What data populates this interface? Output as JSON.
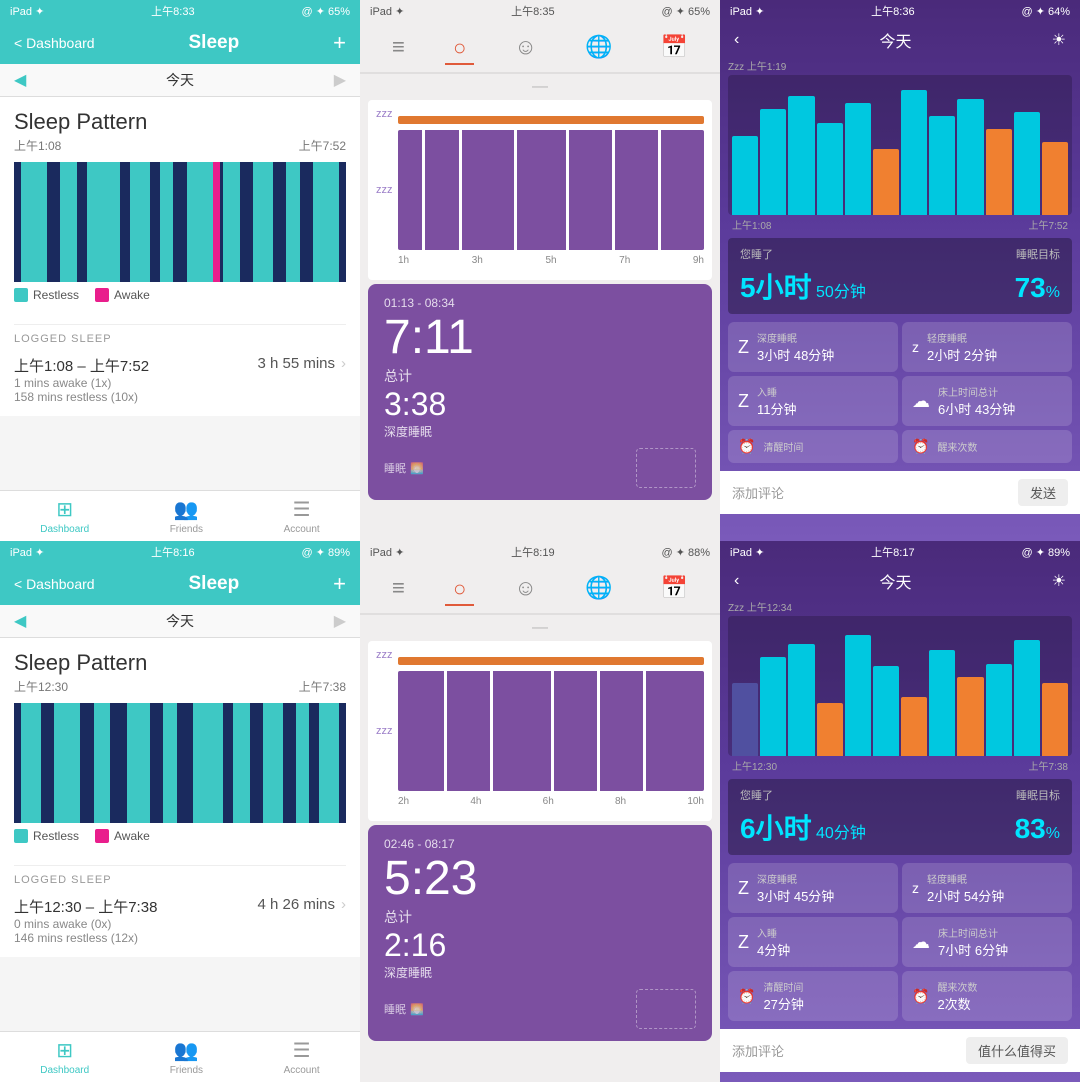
{
  "panels": {
    "topLeft": {
      "statusBar": {
        "left": "iPad ✦",
        "time": "上午8:33",
        "right": "@ ✦ 65%"
      },
      "navBack": "< Dashboard",
      "navTitle": "Sleep",
      "navAdd": "+",
      "dateLabel": "今天",
      "sleepPatternTitle": "Sleep Pattern",
      "startTime": "上午1:08",
      "endTime": "上午7:52",
      "legend": [
        {
          "color": "#3ec8c4",
          "label": "Restless"
        },
        {
          "color": "#e91e8c",
          "label": "Awake"
        }
      ],
      "loggedSleepLabel": "LOGGED SLEEP",
      "entry": {
        "timeRange": "上午1:08 – 上午7:52",
        "detail1": "1 mins awake (1x)",
        "detail2": "158 mins restless (10x)",
        "duration": "3 h 55 mins"
      },
      "tabs": [
        {
          "icon": "⊞",
          "label": "Dashboard",
          "active": true
        },
        {
          "icon": "👥",
          "label": "Friends",
          "active": false
        },
        {
          "icon": "☰",
          "label": "Account",
          "active": false
        }
      ]
    },
    "topMiddle": {
      "statusBar": {
        "left": "iPad ✦",
        "time": "上午8:35",
        "right": "@ ✦ 65%"
      },
      "navIcons": [
        "≡",
        "○",
        "☺",
        "🌐",
        "📅"
      ],
      "activeNavIndex": 1,
      "zzzTop": "zzz",
      "zzzMid": "zzz",
      "timeLabels": [
        "1h",
        "3h",
        "5h",
        "7h",
        "9h"
      ],
      "cardTimeRange": "01:13 - 08:34",
      "cardMainTime": "7:11",
      "cardTotalLabel": "总计",
      "cardDeepTime": "3:38",
      "cardDeepLabel": "深度睡眠",
      "cardFooter": "睡眠"
    },
    "topRight": {
      "statusBar": {
        "left": "iPad ✦",
        "time": "上午8:36",
        "right": "@ ✦ 64%"
      },
      "navTitle": "今天",
      "zzzLabel": "Zzz 上午1:19",
      "timeStart": "上午1:08",
      "timeEnd": "上午7:52",
      "sleptLabel": "您睡了",
      "goalLabel": "睡眠目标",
      "bigHours": "5小时",
      "bigMin": "50分钟",
      "percent": "73",
      "percentSign": "%",
      "stats": [
        {
          "icon": "Z",
          "label": "深度睡眠",
          "value": "3小时 48分钟"
        },
        {
          "icon": "z",
          "label": "轻度睡眠",
          "value": "2小时 2分钟"
        },
        {
          "icon": "Z",
          "label": "入睡",
          "value": "11分钟"
        },
        {
          "icon": "☁",
          "label": "床上时间总计",
          "value": "6小时 43分钟"
        },
        {
          "icon": "⏰",
          "label": "清醒时间",
          "value": ""
        },
        {
          "icon": "⏰",
          "label": "醒来次数",
          "value": ""
        }
      ],
      "commentPlaceholder": "添加评论",
      "sendLabel": "发送"
    },
    "bottomLeft": {
      "statusBar": {
        "left": "iPad ✦",
        "time": "上午8:16",
        "right": "@ ✦ 89%"
      },
      "navBack": "< Dashboard",
      "navTitle": "Sleep",
      "navAdd": "+",
      "dateLabel": "今天",
      "sleepPatternTitle": "Sleep Pattern",
      "startTime": "上午12:30",
      "endTime": "上午7:38",
      "loggedSleepLabel": "LOGGED SLEEP",
      "entry": {
        "timeRange": "上午12:30 – 上午7:38",
        "detail1": "0 mins awake (0x)",
        "detail2": "146 mins restless (12x)",
        "duration": "4 h 26 mins"
      },
      "tabs": [
        {
          "icon": "⊞",
          "label": "Dashboard",
          "active": true
        },
        {
          "icon": "👥",
          "label": "Friends",
          "active": false
        },
        {
          "icon": "☰",
          "label": "Account",
          "active": false
        }
      ]
    },
    "bottomMiddle": {
      "statusBar": {
        "left": "iPad ✦",
        "time": "上午8:19",
        "right": "@ ✦ 88%"
      },
      "zzzTop": "zzz",
      "zzzMid": "zzz",
      "timeLabels": [
        "2h",
        "4h",
        "6h",
        "8h",
        "10h"
      ],
      "cardTimeRange": "02:46 - 08:17",
      "cardMainTime": "5:23",
      "cardTotalLabel": "总计",
      "cardDeepTime": "2:16",
      "cardDeepLabel": "深度睡眠",
      "cardFooter": "睡眠"
    },
    "bottomRight": {
      "statusBar": {
        "left": "iPad ✦",
        "time": "上午8:17",
        "right": "@ ✦ 89%"
      },
      "navTitle": "今天",
      "zzzLabel": "Zzz 上午12:34",
      "timeStart": "上午12:30",
      "timeEnd": "上午7:38",
      "sleptLabel": "您睡了",
      "goalLabel": "睡眠目标",
      "bigHours": "6小时",
      "bigMin": "40分钟",
      "percent": "83",
      "percentSign": "%",
      "stats": [
        {
          "icon": "Z",
          "label": "深度睡眠",
          "value": "3小时 45分钟"
        },
        {
          "icon": "z",
          "label": "轻度睡眠",
          "value": "2小时 54分钟"
        },
        {
          "icon": "Z",
          "label": "入睡",
          "value": "4分钟"
        },
        {
          "icon": "☁",
          "label": "床上时间总计",
          "value": "7小时 6分钟"
        },
        {
          "icon": "⏰",
          "label": "清醒时间",
          "value": "27分钟"
        },
        {
          "icon": "⏰",
          "label": "醒来次数",
          "value": "2次数"
        }
      ],
      "commentPlaceholder": "添加评论",
      "sendLabel": "值什么值得买"
    }
  }
}
